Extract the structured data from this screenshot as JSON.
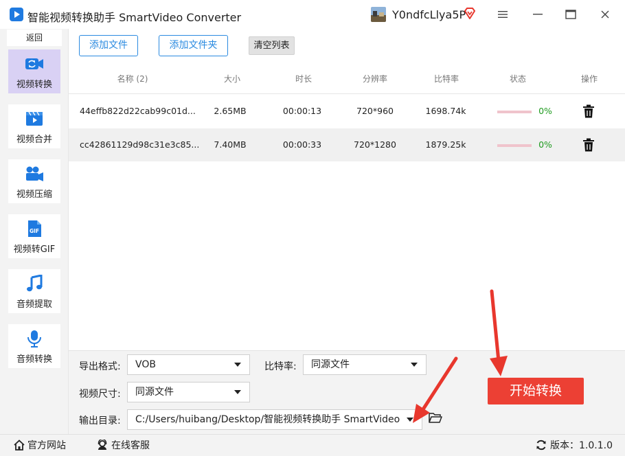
{
  "app": {
    "title": "智能视频转换助手 SmartVideo Converter",
    "username": "Y0ndfcLlya5P"
  },
  "sidebar": {
    "back_label": "返回",
    "items": [
      {
        "label": "视频转换",
        "icon": "video-convert-icon",
        "active": true
      },
      {
        "label": "视频合并",
        "icon": "video-merge-icon",
        "active": false
      },
      {
        "label": "视频压缩",
        "icon": "video-compress-icon",
        "active": false
      },
      {
        "label": "视频转GIF",
        "icon": "gif-icon",
        "active": false
      },
      {
        "label": "音频提取",
        "icon": "music-note-icon",
        "active": false
      },
      {
        "label": "音频转换",
        "icon": "microphone-icon",
        "active": false
      }
    ]
  },
  "toolbar": {
    "add_file": "添加文件",
    "add_folder": "添加文件夹",
    "clear_list": "清空列表"
  },
  "table": {
    "headers": {
      "name": "名称 (2)",
      "size": "大小",
      "duration": "时长",
      "resolution": "分辨率",
      "bitrate": "比特率",
      "status": "状态",
      "action": "操作"
    },
    "rows": [
      {
        "name": "44effb822d22cab99c01d...",
        "size": "2.65MB",
        "duration": "00:00:13",
        "resolution": "720*960",
        "bitrate": "1698.74k",
        "progress": 0,
        "status": "0%"
      },
      {
        "name": "cc42861129d98c31e3c85...",
        "size": "7.40MB",
        "duration": "00:00:33",
        "resolution": "720*1280",
        "bitrate": "1879.25k",
        "progress": 0,
        "status": "0%"
      }
    ]
  },
  "settings": {
    "format_label": "导出格式:",
    "format_value": "VOB",
    "bitrate_label": "比特率:",
    "bitrate_value": "同源文件",
    "size_label": "视频尺寸:",
    "size_value": "同源文件",
    "output_label": "输出目录:",
    "output_value": "C:/Users/huibang/Desktop/智能视频转换助手 SmartVideo"
  },
  "start_button": "开始转换",
  "footer": {
    "website": "官方网站",
    "support": "在线客服",
    "version": "版本：1.0.1.0"
  },
  "colors": {
    "accent_blue": "#2a8ae0",
    "start_red": "#ec4034",
    "active_nav": "#d9d1f4",
    "progress_green": "#1e9a1e",
    "annotation_red": "#e8372d"
  }
}
